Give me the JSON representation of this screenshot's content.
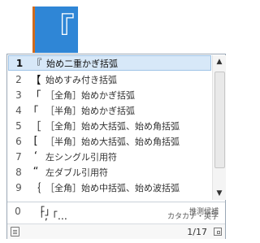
{
  "composition": {
    "text": "『"
  },
  "candidates": [
    {
      "num": "1",
      "glyph": "『",
      "label": "始め二重かぎ括弧"
    },
    {
      "num": "2",
      "glyph": "【",
      "label": "始めすみ付き括弧"
    },
    {
      "num": "3",
      "glyph": "「",
      "label": "［全角］始めかぎ括弧"
    },
    {
      "num": "4",
      "glyph": "｢",
      "label": "［半角］始めかぎ括弧"
    },
    {
      "num": "5",
      "glyph": "［",
      "label": "［全角］始め大括弧、始め角括弧"
    },
    {
      "num": "6",
      "glyph": "[",
      "label": "［半角］始め大括弧、始め角括弧"
    },
    {
      "num": "7",
      "glyph": "‘",
      "label": "左シングル引用符"
    },
    {
      "num": "8",
      "glyph": "“",
      "label": "左ダブル引用符"
    },
    {
      "num": "9",
      "glyph": "｛",
      "label": "［全角］始め中括弧、始め波括弧"
    }
  ],
  "extra": [
    {
      "num": "0",
      "text": "「」",
      "hint": "推測候補"
    },
    {
      "num": "",
      "text": "「,「…",
      "hint": "カタカナ・英字"
    }
  ],
  "status": {
    "page": "1/17"
  },
  "icons": {
    "scroll_up": "scroll-up-icon",
    "scroll_down": "scroll-down-icon",
    "notes": "notes-icon",
    "resize": "resize-icon"
  }
}
